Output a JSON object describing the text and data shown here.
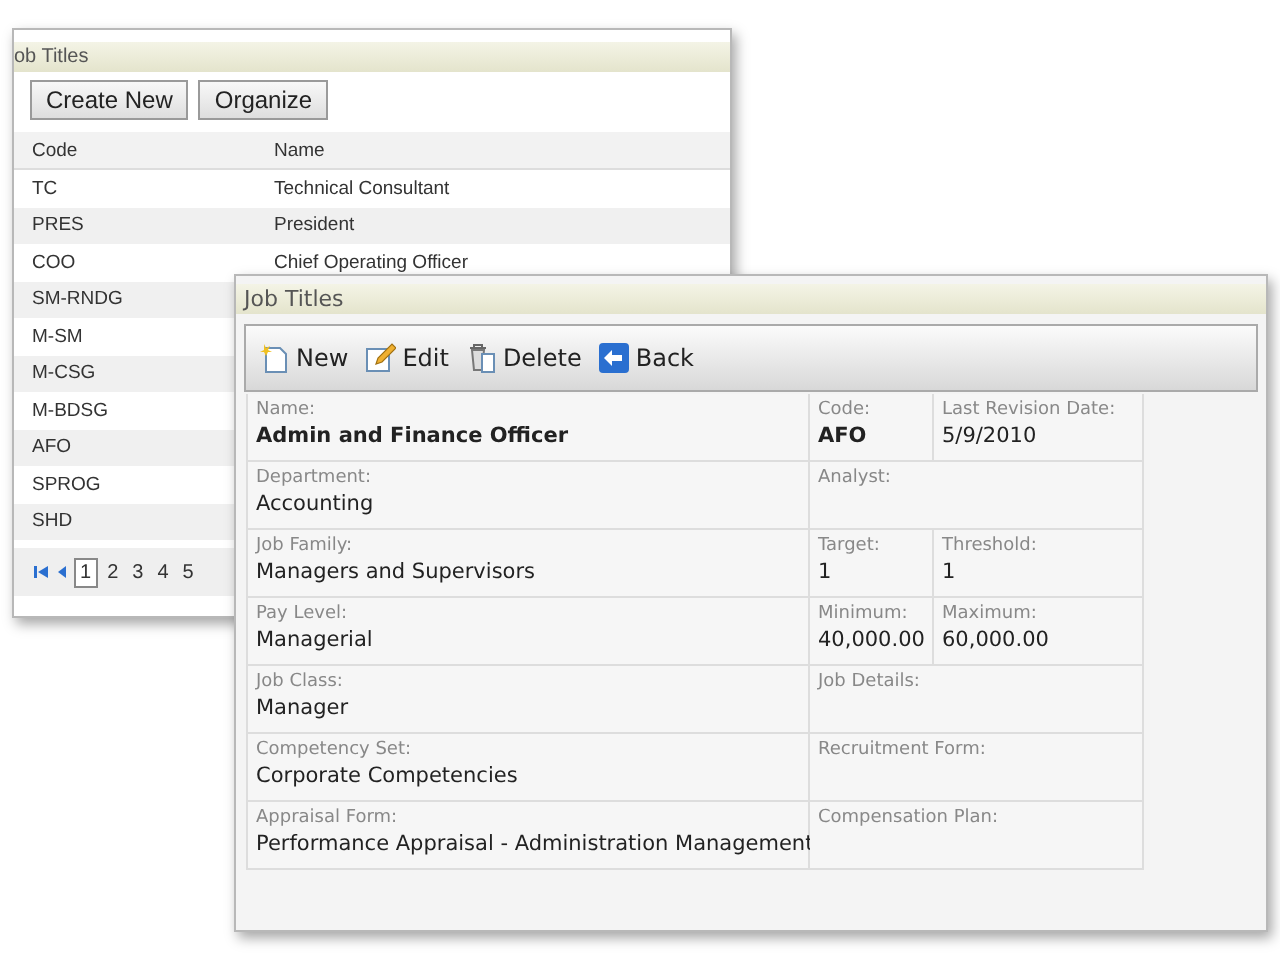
{
  "back_window": {
    "title": "ob Titles",
    "buttons": [
      "Create New",
      "Organize"
    ],
    "columns": [
      "Code",
      "Name"
    ],
    "rows": [
      {
        "code": "TC",
        "name": "Technical Consultant"
      },
      {
        "code": "PRES",
        "name": "President"
      },
      {
        "code": "COO",
        "name": "Chief Operating Officer"
      },
      {
        "code": "SM-RNDG"
      },
      {
        "code": "M-SM"
      },
      {
        "code": "M-CSG"
      },
      {
        "code": "M-BDSG"
      },
      {
        "code": "AFO"
      },
      {
        "code": "SPROG"
      },
      {
        "code": "SHD"
      }
    ],
    "pager": [
      {
        "label": "1",
        "selected": true
      },
      {
        "label": "2",
        "selected": false
      },
      {
        "label": "3",
        "selected": false
      },
      {
        "label": "4",
        "selected": false
      },
      {
        "label": "5",
        "selected": false
      }
    ]
  },
  "front_window": {
    "title": "Job Titles",
    "toolbar": [
      {
        "kind": "new",
        "label": "New"
      },
      {
        "kind": "edit",
        "label": "Edit"
      },
      {
        "kind": "delete",
        "label": "Delete"
      },
      {
        "kind": "back",
        "label": "Back"
      }
    ],
    "rows": [
      [
        {
          "label": "Name:",
          "value": "Admin and Finance Officer",
          "bold": true
        },
        {
          "label": "Code:",
          "value": "AFO",
          "bold": true
        },
        {
          "label": "Last Revision Date:",
          "value": "5/9/2010",
          "bold": false
        }
      ],
      [
        {
          "label": "Department:",
          "value": "Accounting",
          "bold": false
        },
        {
          "label": "Analyst:"
        }
      ],
      [
        {
          "label": "Job Family:",
          "value": "Managers and Supervisors",
          "bold": false
        },
        {
          "label": "Target:",
          "value": "1",
          "bold": false
        },
        {
          "label": "Threshold:",
          "value": "1",
          "bold": false
        }
      ],
      [
        {
          "label": "Pay Level:",
          "value": "Managerial",
          "bold": false
        },
        {
          "label": "Minimum:",
          "value": "40,000.00",
          "bold": false
        },
        {
          "label": "Maximum:",
          "value": "60,000.00",
          "bold": false
        }
      ],
      [
        {
          "label": "Job Class:",
          "value": "Manager",
          "bold": false
        },
        {
          "label": "Job Details:"
        }
      ],
      [
        {
          "label": "Competency Set:",
          "value": "Corporate Competencies",
          "bold": false
        },
        {
          "label": "Recruitment Form:"
        }
      ],
      [
        {
          "label": "Appraisal Form:",
          "value": "Performance Appraisal - Administration Management",
          "bold": false
        },
        {
          "label": "Compensation Plan:"
        }
      ]
    ]
  }
}
